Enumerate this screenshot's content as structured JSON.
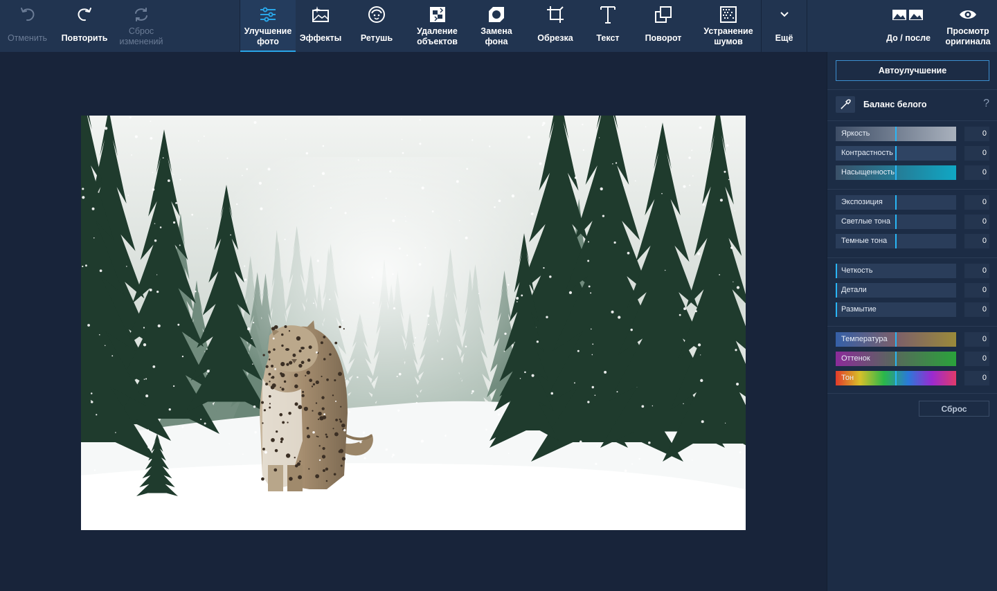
{
  "toolbar": {
    "undo": "Отменить",
    "redo": "Повторить",
    "reset_changes": "Сброс\nизменений",
    "enhance": "Улучшение\nфото",
    "effects": "Эффекты",
    "retouch": "Ретушь",
    "object_removal": "Удаление\nобъектов",
    "bg_replace": "Замена\nфона",
    "crop": "Обрезка",
    "text": "Текст",
    "rotate": "Поворот",
    "denoise": "Устранение\nшумов",
    "more": "Ещё",
    "before_after": "До / после",
    "view_original": "Просмотр\nоригинала"
  },
  "panel": {
    "auto_enhance": "Автоулучшение",
    "white_balance": "Баланс белого",
    "help": "?",
    "reset": "Сброс",
    "groups": [
      [
        {
          "label": "Яркость",
          "value": "0"
        },
        {
          "label": "Контрастность",
          "value": "0"
        },
        {
          "label": "Насыщенность",
          "value": "0"
        }
      ],
      [
        {
          "label": "Экспозиция",
          "value": "0"
        },
        {
          "label": "Светлые тона",
          "value": "0"
        },
        {
          "label": "Темные тона",
          "value": "0"
        }
      ],
      [
        {
          "label": "Четкость",
          "value": "0"
        },
        {
          "label": "Детали",
          "value": "0"
        },
        {
          "label": "Размытие",
          "value": "0"
        }
      ],
      [
        {
          "label": "Температура",
          "value": "0"
        },
        {
          "label": "Оттенок",
          "value": "0"
        },
        {
          "label": "Тон",
          "value": "0"
        }
      ]
    ]
  },
  "colors": {
    "toolbar_bg": "#213450",
    "canvas_bg": "#18243a",
    "panel_bg": "#1c2c45",
    "accent": "#29b6f6"
  }
}
